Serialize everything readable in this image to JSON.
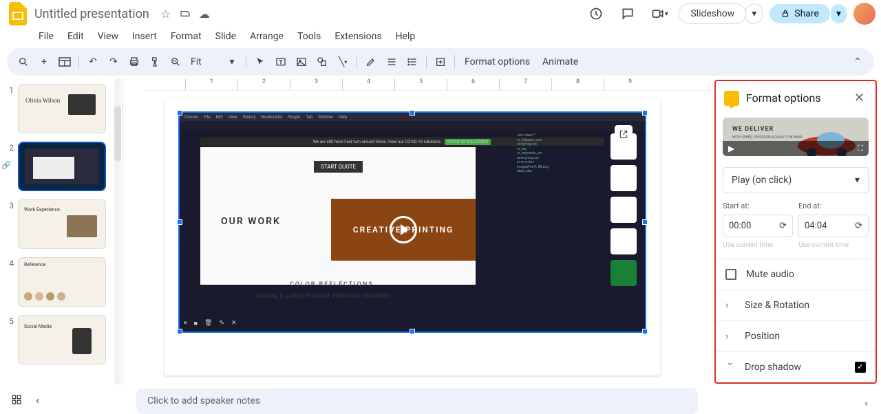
{
  "header": {
    "title": "Untitled presentation",
    "slideshow": "Slideshow",
    "share": "Share"
  },
  "menu": [
    "File",
    "Edit",
    "View",
    "Insert",
    "Format",
    "Slide",
    "Arrange",
    "Tools",
    "Extensions",
    "Help"
  ],
  "toolbar": {
    "zoom": "Fit",
    "format_options": "Format options",
    "animate": "Animate"
  },
  "ruler": [
    "1",
    "2",
    "3",
    "4",
    "5",
    "6",
    "7",
    "8",
    "9"
  ],
  "slides": [
    {
      "num": "1",
      "title": "Olivia Wilson"
    },
    {
      "num": "2",
      "title": ""
    },
    {
      "num": "3",
      "title": "Work Experience"
    },
    {
      "num": "4",
      "title": "Reference"
    },
    {
      "num": "5",
      "title": "Social Media"
    }
  ],
  "video": {
    "quote": "START QUOTE",
    "our_work": "OUR WORK",
    "creative": "CREATIVE PRINTING",
    "color_reflections": "COLOR REFLECTIONS",
    "subtitle": "DIGITAL & LARGE FORMAT PRINTING COMPANY",
    "covid": "COVID-19 SOLUTIONS",
    "covid_msg": "We are still here! Fast turn around times. View our COVID-19 solutions"
  },
  "panel": {
    "title": "Format options",
    "preview": {
      "deliver": "WE DELIVER",
      "sub": "WITH SPEED, PRECISION &\nQUALITY IN MIND"
    },
    "play_mode": "Play (on click)",
    "start_label": "Start at:",
    "end_label": "End at:",
    "start_value": "00:00",
    "end_value": "04:04",
    "use_current": "Use current time",
    "mute": "Mute audio",
    "size": "Size & Rotation",
    "position": "Position",
    "shadow": "Drop shadow"
  },
  "notes": "Click to add speaker notes"
}
